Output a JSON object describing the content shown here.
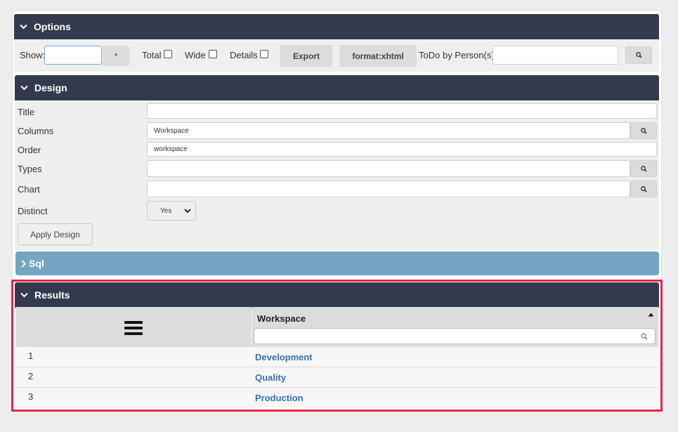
{
  "options": {
    "header": "Options",
    "show_label": "Show:",
    "show_value": "",
    "star_button": "*",
    "total_label": "Total",
    "wide_label": "Wide",
    "details_label": "Details",
    "export_button": "Export",
    "format_button": "format:xhtml",
    "todo_label": "ToDo by Person(s)",
    "todo_value": ""
  },
  "design": {
    "header": "Design",
    "title_label": "Title",
    "title_value": "",
    "columns_label": "Columns",
    "columns_value": "Workspace",
    "order_label": "Order",
    "order_value": "workspace",
    "types_label": "Types",
    "types_value": "",
    "chart_label": "Chart",
    "chart_value": "",
    "distinct_label": "Distinct",
    "distinct_value": "Yes",
    "apply_button": "Apply Design"
  },
  "sql": {
    "header": "Sql"
  },
  "results": {
    "header": "Results",
    "column_header": "Workspace",
    "filter_value": "",
    "rows": [
      {
        "num": "1",
        "workspace": "Development"
      },
      {
        "num": "2",
        "workspace": "Quality"
      },
      {
        "num": "3",
        "workspace": "Production"
      }
    ]
  },
  "icons": {
    "chevron_down": "chevron-down-icon",
    "chevron_right": "chevron-right-icon",
    "search": "search-icon",
    "menu": "hamburger-menu-icon",
    "sort": "sort-asc-icon"
  },
  "colors": {
    "header_dark": "#343a4e",
    "sql_blue": "#75a5c3",
    "highlight": "#e8234a",
    "link": "#3a6fb3"
  }
}
